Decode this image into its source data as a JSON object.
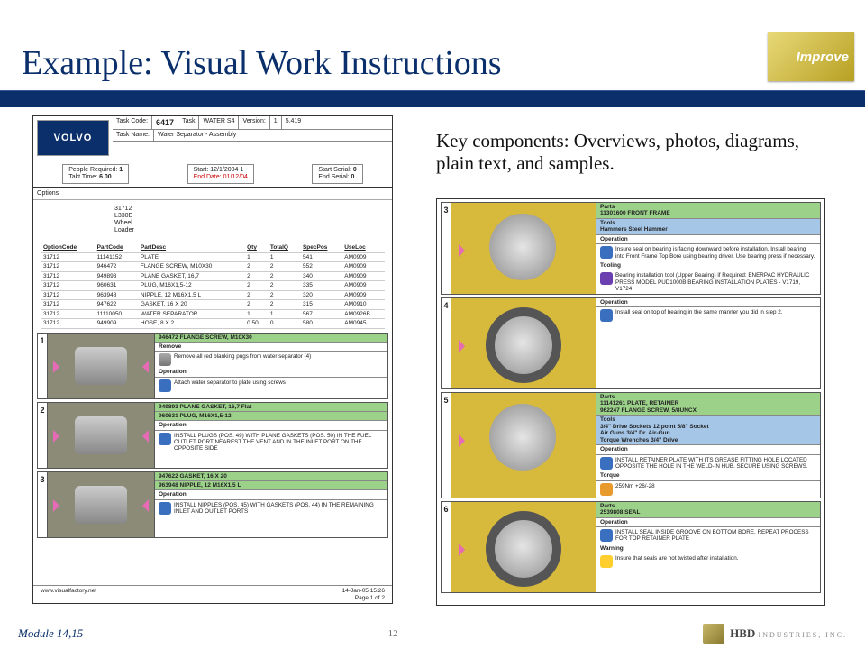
{
  "badge": "Improve",
  "title": "Example: Visual Work Instructions",
  "key_text": "Key components: Overviews, photos, diagrams, plain text, and samples.",
  "header": {
    "brand": "VOLVO",
    "task_code_label": "Task Code:",
    "task_code": "6417",
    "task_label": "Task",
    "task": "WATER S4",
    "version_label": "Version:",
    "version": "1",
    "rev": "5,419",
    "task_name_label": "Task Name:",
    "task_name": "Water Separator - Assembly"
  },
  "info": {
    "people_label": "People Required:",
    "people": "1",
    "takt_label": "Takt Time:",
    "takt": "6.00",
    "start_label": "Start:",
    "start": "12/1/2004 1",
    "end_label": "End Date:",
    "end": "01/12/04",
    "start_serial_label": "Start Serial:",
    "start_serial": "0",
    "end_serial_label": "End Serial:",
    "end_serial": "0"
  },
  "options_label": "Options",
  "options_list": [
    "31712",
    "L330E",
    "Wheel",
    "Loader"
  ],
  "parts_headers": [
    "OptionCode",
    "PartCode",
    "PartDesc",
    "Qty",
    "TotalQ",
    "SpecPos",
    "UseLoc"
  ],
  "parts_rows": [
    [
      "31712",
      "11141152",
      "PLATE",
      "1",
      "1",
      "541",
      "AM0909"
    ],
    [
      "31712",
      "946472",
      "FLANGE SCREW, M10X30",
      "2",
      "2",
      "552",
      "AM0909"
    ],
    [
      "31712",
      "949893",
      "PLANE GASKET, 16,7",
      "2",
      "2",
      "340",
      "AM0909"
    ],
    [
      "31712",
      "960631",
      "PLUG, M16X1,5-12",
      "2",
      "2",
      "335",
      "AM0909"
    ],
    [
      "31712",
      "963948",
      "NIPPLE, 12 M16X1,5 L",
      "2",
      "2",
      "320",
      "AM0909"
    ],
    [
      "31712",
      "947622",
      "GASKET, 16 X 20",
      "2",
      "2",
      "315",
      "AM0910"
    ],
    [
      "31712",
      "11110050",
      "WATER SEPARATOR",
      "1",
      "1",
      "567",
      "AM0926B"
    ],
    [
      "31712",
      "949909",
      "HOSE, 8 X 2",
      "0.50",
      "0",
      "580",
      "AM0945"
    ]
  ],
  "left_steps": [
    {
      "num": "1",
      "green": "946472 FLANGE SCREW, M10X30",
      "sections": [
        {
          "label": "Remove",
          "text": "Remove all red blanking pugs from water separator (4)"
        },
        {
          "label": "Operation",
          "text": "Attach water separator to plate using screws"
        }
      ]
    },
    {
      "num": "2",
      "green": "949893 PLANE GASKET, 16,7        Flat",
      "extra": "960631 PLUG, M16X1,5-12",
      "sections": [
        {
          "label": "Operation",
          "text": "INSTALL PLUGS (POS. 49) WITH PLANE GASKETS (POS. 50) IN THE FUEL OUTLET PORT NEAREST THE VENT AND IN THE INLET PORT ON THE OPPOSITE SIDE"
        }
      ]
    },
    {
      "num": "3",
      "green": "947622 GASKET, 16 X 20",
      "extra": "963948 NIPPLE, 12 M16X1,5 L",
      "sections": [
        {
          "label": "Operation",
          "text": "INSTALL NIPPLES (POS. 45) WITH GASKETS (POS. 44) IN THE REMAINING INLET AND OUTLET PORTS"
        }
      ]
    }
  ],
  "doc_footer": {
    "site": "www.visualfactory.net",
    "date": "14-Jan-05 15:26",
    "page": "Page 1 of 2"
  },
  "right_steps": [
    {
      "num": "3",
      "parts": [
        "11301600 FRONT FRAME"
      ],
      "tools_header": "Tools",
      "tools": "Hammers               Steel Hammer",
      "sections": [
        {
          "label": "Operation",
          "text": "Insure seal on bearing is facing downward before installation. Install bearing into Front Frame Top Bore using bearing driver. Use bearing press if necessary."
        },
        {
          "label": "Tooling",
          "text": "Bearing installation tool (Upper Bearing) if Required: ENERPAC HYDRAULIC PRESS MODEL PUD1000B BEARING INSTALLATION PLATES - V1719, V1724"
        }
      ]
    },
    {
      "num": "4",
      "sections": [
        {
          "label": "Operation",
          "text": "Install seal on top of bearing in the same manner you did in step 2."
        }
      ]
    },
    {
      "num": "5",
      "parts": [
        "11141261 PLATE, RETAINER",
        "962247 FLANGE SCREW, 5/8UNCX"
      ],
      "tools_header": "Tools",
      "tools": "3/4\" Drive Sockets 12 point     5/8\" Socket\nAir Guns                    3/4\" Dr. Air-Gun\nTorque Wrenches            3/4\" Drive",
      "sections": [
        {
          "label": "Operation",
          "text": "INSTALL RETAINER PLATE WITH ITS GREASE FITTING HOLE LOCATED OPPOSITE THE HOLE IN THE WELD-IN HUB. SECURE USING SCREWS."
        },
        {
          "label": "Torque",
          "text": "259Nm +26/-28"
        }
      ]
    },
    {
      "num": "6",
      "parts": [
        "2539808 SEAL"
      ],
      "sections": [
        {
          "label": "Operation",
          "text": "INSTALL SEAL INSIDE GROOVE ON BOTTOM BORE. REPEAT PROCESS FOR TOP RETAINER PLATE"
        },
        {
          "label": "Warning",
          "text": "Insure that seals are not twisted after installation."
        }
      ]
    }
  ],
  "footer": {
    "module": "Module 14,15",
    "page": "12",
    "company_name": "HBD",
    "company_sub": "INDUSTRIES, INC."
  }
}
